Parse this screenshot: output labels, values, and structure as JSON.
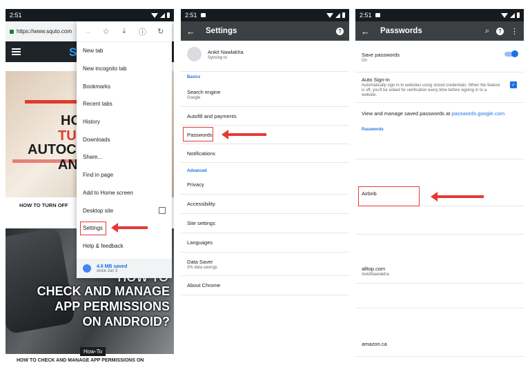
{
  "colors": {
    "accent": "#1a73e8",
    "toolbar": "#3c4043",
    "status_bar": "#161b1f",
    "annotation_red": "#e53935"
  },
  "panel1": {
    "time": "2:51",
    "url": "https://www.squto.com",
    "site_logo": "S",
    "article1": {
      "lines": [
        "HO",
        "TU",
        "AUTOCO",
        "AN"
      ],
      "caption": "HOW TO TURN OFF"
    },
    "article2": {
      "lines": [
        "HOW TO",
        "CHECK AND MANAGE",
        "APP PERMISSIONS",
        "ON ANDROID?"
      ],
      "tag": "How-To",
      "caption": "HOW TO CHECK AND MANAGE APP PERMISSIONS ON"
    },
    "menu_icons": [
      "forward-icon",
      "star-icon",
      "download-icon",
      "info-icon",
      "refresh-icon"
    ],
    "menu_items": [
      "New tab",
      "New incognito tab",
      "Bookmarks",
      "Recent tabs",
      "History",
      "Downloads",
      "Share...",
      "Find in page",
      "Add to Home screen",
      "Desktop site",
      "Settings",
      "Help & feedback"
    ],
    "saved": {
      "amount": "4.6 MB saved",
      "since": "since Jun 3"
    }
  },
  "panel2": {
    "time": "2:51",
    "title": "Settings",
    "account": {
      "name": "Ankit Nawlakha",
      "status": "Syncing to"
    },
    "basics_header": "Basics",
    "search_engine": {
      "title": "Search engine",
      "value": "Google"
    },
    "items": [
      "Autofill and payments",
      "Passwords",
      "Notifications"
    ],
    "advanced_header": "Advanced",
    "advanced_items": [
      "Privacy",
      "Accessibility",
      "Site settings",
      "Languages"
    ],
    "data_saver": {
      "title": "Data Saver",
      "value": "3% data savings"
    },
    "about": "About Chrome"
  },
  "panel3": {
    "time": "2:51",
    "title": "Passwords",
    "save_passwords": {
      "title": "Save passwords",
      "value": "On"
    },
    "auto_signin": {
      "title": "Auto Sign-in",
      "desc": "Automatically sign in to websites using stored credentials. When the feature is off, you'll be asked for verification every time before signing in to a website."
    },
    "manage_text": "View and manage saved passwords at ",
    "manage_link": "passwords.google.com",
    "passwords_header": "Passwords",
    "entries": [
      {
        "site": "Airbnb",
        "user": ""
      },
      {
        "site": "alltop.com",
        "user": "AnkitNawlakha"
      },
      {
        "site": "amazon.ca",
        "user": ""
      }
    ]
  }
}
